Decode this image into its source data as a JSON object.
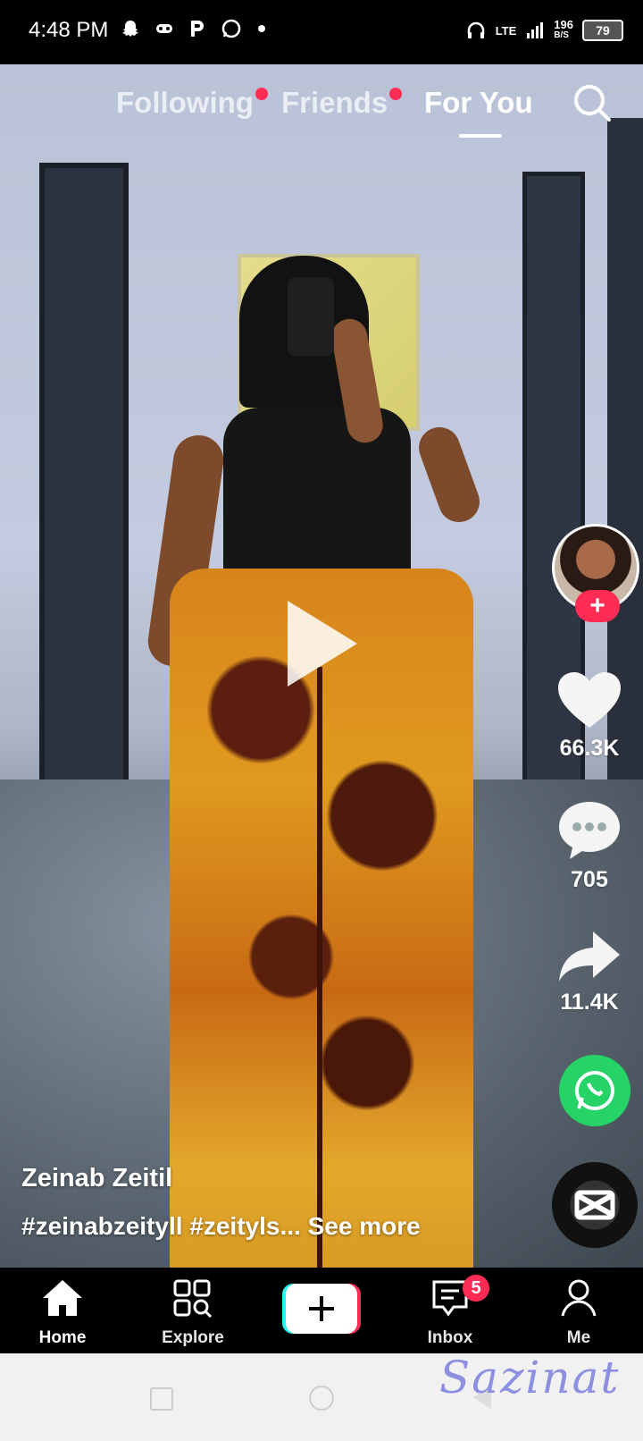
{
  "status_bar": {
    "time": "4:48 PM",
    "network": "LTE",
    "speed_value": "196",
    "speed_unit": "B/S",
    "battery": "79"
  },
  "top_tabs": {
    "following": "Following",
    "friends": "Friends",
    "for_you": "For You",
    "active": "For You"
  },
  "video": {
    "username": "Zeinab Zeitil",
    "caption": "#zeinabzeityll #zeityls...",
    "see_more": "See more"
  },
  "actions": {
    "likes": "66.3K",
    "comments": "705",
    "shares": "11.4K"
  },
  "bottom_nav": {
    "home": "Home",
    "explore": "Explore",
    "inbox": "Inbox",
    "inbox_badge": "5",
    "me": "Me"
  },
  "watermark": "Sazinat",
  "colors": {
    "accent": "#fe2c55",
    "whatsapp": "#25d366",
    "background": "#000000"
  }
}
